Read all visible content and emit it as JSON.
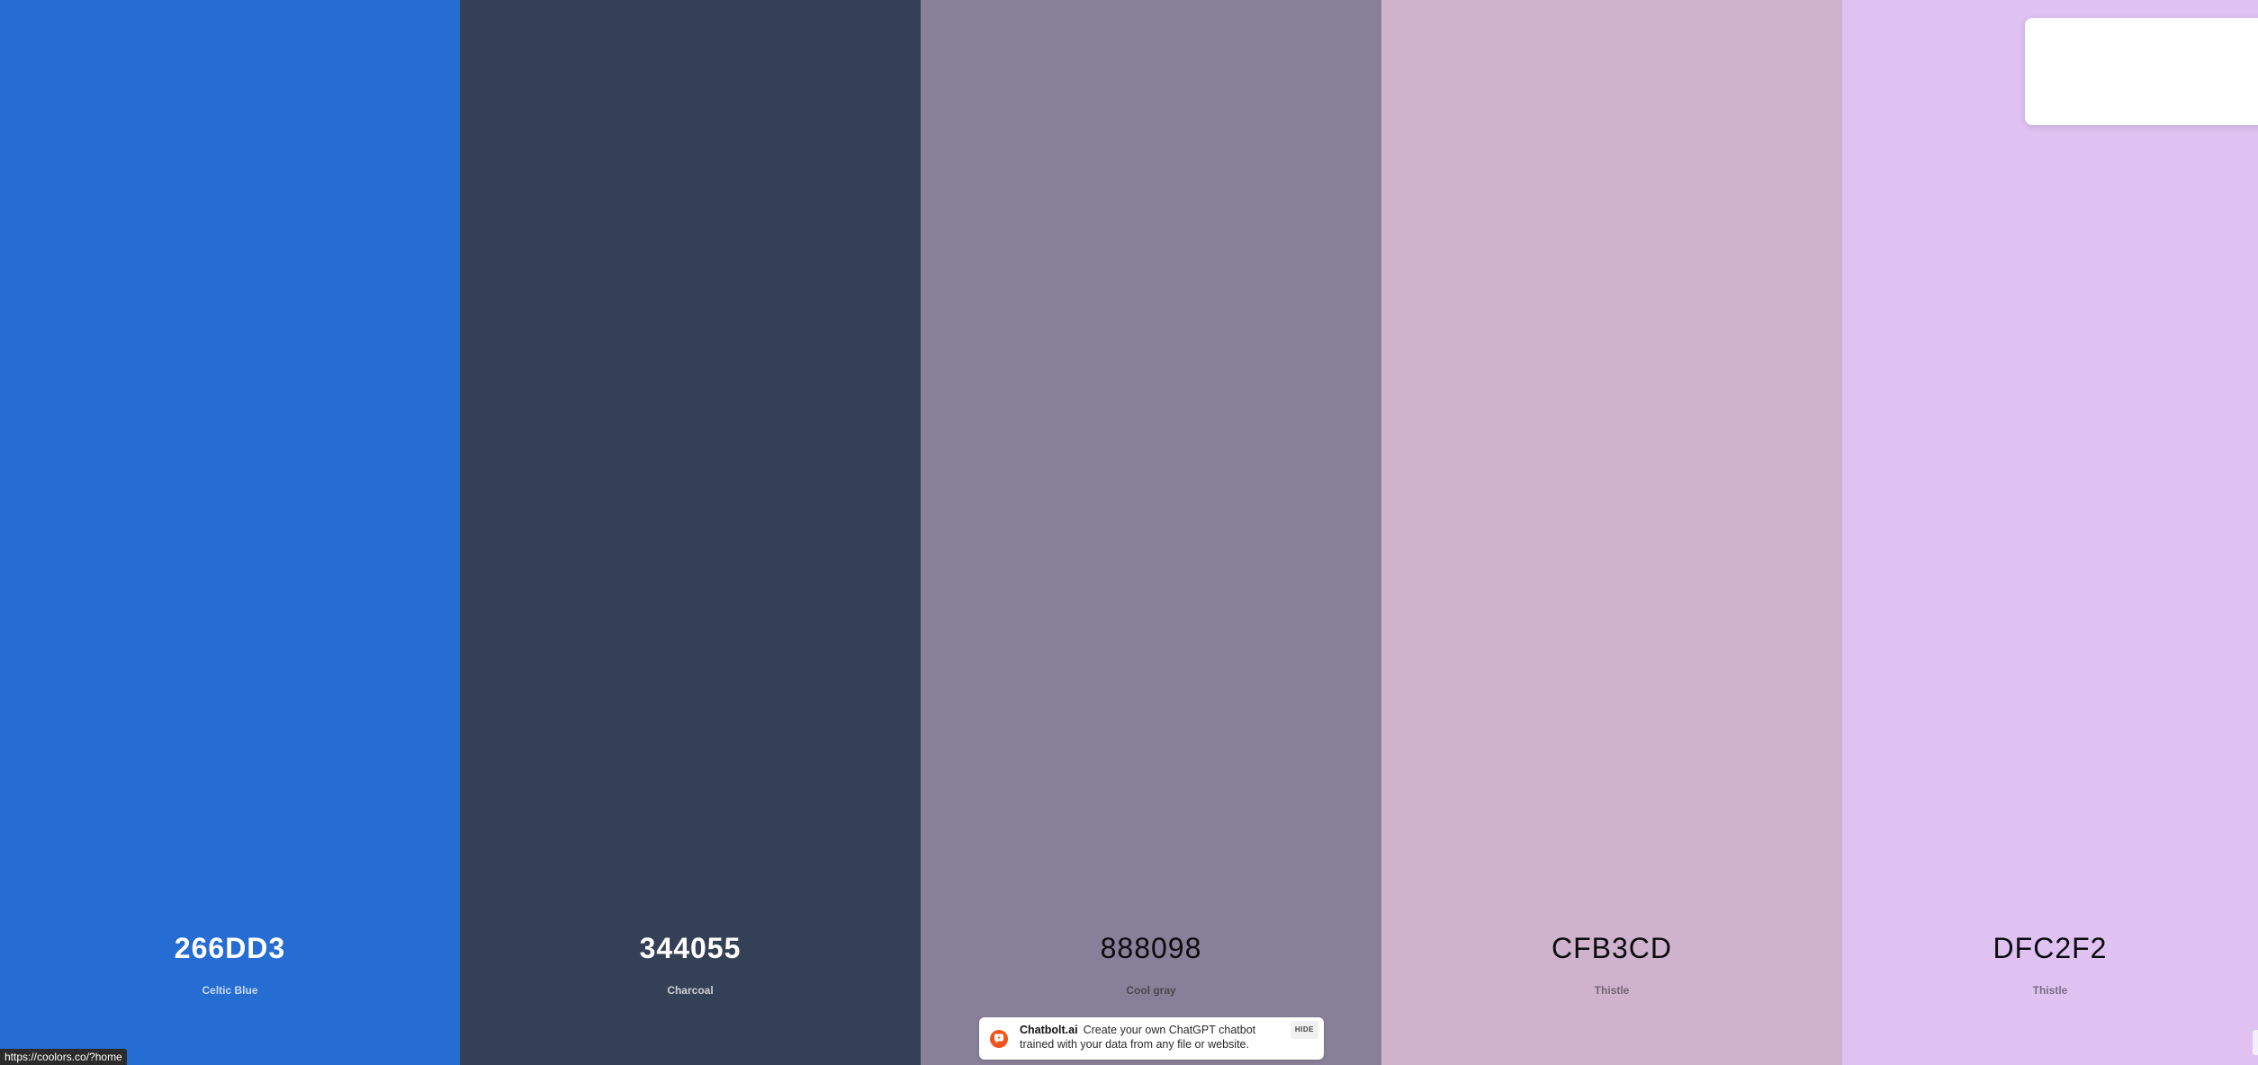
{
  "palette": {
    "swatches": [
      {
        "hex": "266DD3",
        "name": "Celtic Blue",
        "color": "#266DD3",
        "text_theme": "light"
      },
      {
        "hex": "344055",
        "name": "Charcoal",
        "color": "#344055",
        "text_theme": "light"
      },
      {
        "hex": "888098",
        "name": "Cool gray",
        "color": "#888098",
        "text_theme": "dark"
      },
      {
        "hex": "CFB3CD",
        "name": "Thistle",
        "color": "#CFB3CD",
        "text_theme": "dark"
      },
      {
        "hex": "DFC2F2",
        "name": "Thistle",
        "color": "#DFC2F2",
        "text_theme": "dark"
      }
    ]
  },
  "ad": {
    "brand": "Chatbolt.ai",
    "text": "Create your own ChatGPT chatbot trained with your data from any file or website.",
    "hide_label": "HIDE",
    "logo_icon": "chatbolt-logo-icon",
    "logo_color": "#F2541B"
  },
  "status_bar": {
    "url": "https://coolors.co/?home"
  }
}
